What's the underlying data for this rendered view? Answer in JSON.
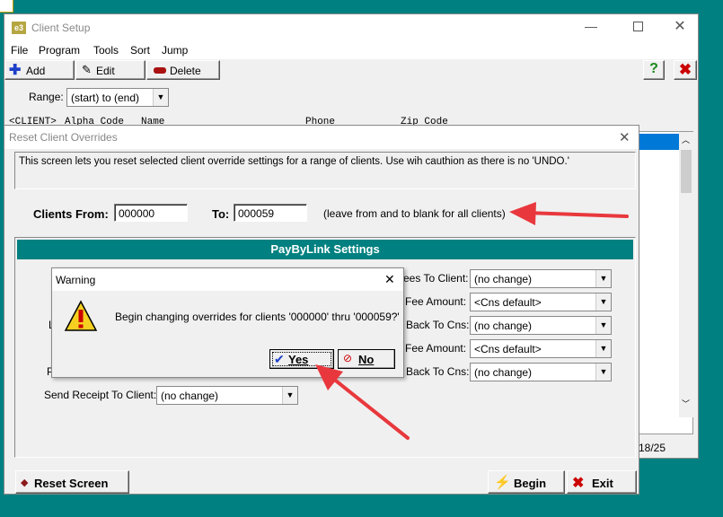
{
  "main": {
    "title": "Client Setup",
    "app_icon": "e3",
    "menu": [
      "File",
      "Program",
      "Tools",
      "Sort",
      "Jump"
    ],
    "toolbar": {
      "add": "Add",
      "edit": "Edit",
      "delete": "Delete"
    },
    "range_label": "Range:",
    "range_value": "(start) to (end)",
    "columns": [
      "<CLIENT>",
      "Alpha Code",
      "Name",
      "Phone",
      "Zip Code"
    ],
    "status_fragment": "18/25"
  },
  "reset": {
    "title": "Reset Client Overrides",
    "info": "This screen lets you reset selected client override settings for a range of clients.  Use wih cauthion as there is no 'UNDO.'",
    "clients_from_label": "Clients From:",
    "clients_from_value": "000000",
    "to_label": "To:",
    "to_value": "000059",
    "hint": "(leave from and to blank for all clients)",
    "section_title": "PayByLink Settings",
    "right_rows": [
      {
        "label": "ees To Client:",
        "value": "(no change)"
      },
      {
        "label": "Fee Amount:",
        "value": "<Cns default>"
      },
      {
        "label": "Back To Cns:",
        "value": "(no change)"
      },
      {
        "label": "Fee Amount:",
        "value": "<Cns default>"
      },
      {
        "label": "Back To Cns:",
        "value": "(no change)"
      }
    ],
    "left_frag_1": "L",
    "left_frag_2": "P",
    "send_receipt_label": "Send Receipt To Client:",
    "send_receipt_value": "(no change)",
    "reset_screen": "Reset Screen",
    "begin": "Begin",
    "exit": "Exit"
  },
  "warning": {
    "title": "Warning",
    "message": "Begin changing overrides for clients '000000' thru '000059?'",
    "yes": "Yes",
    "no": "No"
  },
  "colors": {
    "teal": "#008080",
    "section": "#008080",
    "arrow": "#e8383d",
    "selection": "#0078d7"
  }
}
